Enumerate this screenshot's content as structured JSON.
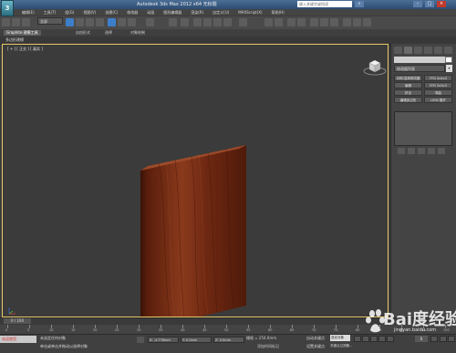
{
  "titlebar": {
    "title": "Autodesk 3ds Max  2012 x64      无标题",
    "search_placeholder": "键入关键字或短语",
    "logo": "3"
  },
  "menubar": {
    "items": [
      "编辑(E)",
      "工具(T)",
      "组(G)",
      "视图(V)",
      "创建(C)",
      "修改器",
      "动画",
      "图形编辑器",
      "渲染(R)",
      "自定义(U)",
      "MAXScript(X)",
      "帮助(H)"
    ]
  },
  "toolbar": {
    "selection_filter": "全部"
  },
  "ribbon": {
    "tabs": [
      "Graphite 建模工具",
      "自由形式",
      "选择",
      "对象绘制"
    ],
    "selected_tab": "Graphite 建模工具",
    "sub_label": "多边形建模"
  },
  "viewport": {
    "label": "[ + ] [ 正交 ] [ 真实 ]"
  },
  "command_panel": {
    "modifier_list": "修改器列表",
    "buttons": [
      "对称/选择修改器",
      "FFD 4x4x4",
      "编辑",
      "FFD 3x3x3",
      "挤出",
      "弯曲",
      "编辑多边形",
      "UVW 展开"
    ],
    "color": "#ffffff"
  },
  "timeline": {
    "slider_label": "0 / 100",
    "ticks": [
      "0",
      "5",
      "10",
      "15",
      "20",
      "25",
      "30",
      "35",
      "40",
      "45",
      "50",
      "55",
      "60",
      "65",
      "70",
      "75",
      "80",
      "85",
      "90",
      "95",
      "100"
    ]
  },
  "status": {
    "maxscript": "欢迎使用",
    "line1": "未选定任何对象",
    "line2": "单击或单击并拖动以选择对象",
    "x_label": "X:",
    "x_value": "-4.778mm",
    "y_label": "Y:",
    "y_value": "0.0mm",
    "z_label": "Z:",
    "z_value": "0.0mm",
    "grid": "栅格 = 254.0mm",
    "add_time_tag": "添加时间标记",
    "auto_key": "自动关键点",
    "selected_object": "选定对象",
    "set_key": "设置关键点",
    "key_filter": "关键点过滤器...",
    "frame": "0"
  },
  "watermark": {
    "brand": "Bai度经验",
    "url": "jingyan.baidu.com"
  },
  "colors": {
    "wood_light": "#8a3a1c",
    "wood_dark": "#4f1a0a",
    "viewport_border": "#e6c96a",
    "title_bar": "#2c4c72"
  }
}
